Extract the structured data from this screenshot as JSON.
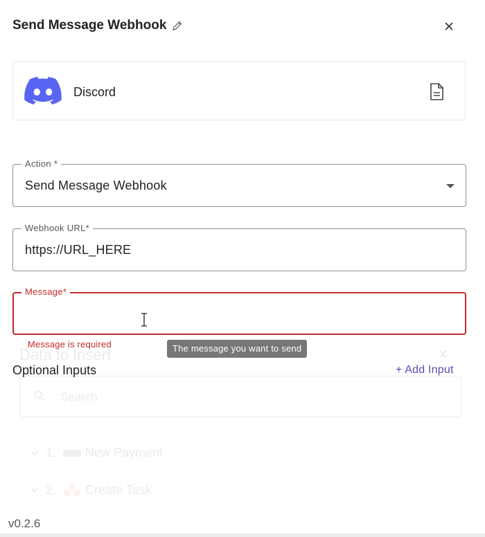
{
  "header": {
    "title": "Send Message Webhook",
    "edit_icon": "pencil-icon",
    "close_icon": "close-icon"
  },
  "app": {
    "name": "Discord",
    "logo": "discord-logo",
    "doc_icon": "document-icon",
    "brand_color": "#5865F2"
  },
  "fields": {
    "action": {
      "label": "Action *",
      "value": "Send Message Webhook"
    },
    "webhook": {
      "label": "Webhook URL*",
      "value": "https://URL_HERE"
    },
    "message": {
      "label": "Message*",
      "value": "",
      "error": "Message is required",
      "tooltip": "The message you want to send",
      "error_color": "#c62828"
    }
  },
  "optional": {
    "label": "Optional Inputs",
    "add_label": "+ Add Input"
  },
  "ghost_panel": {
    "title": "Data to Insert",
    "search_placeholder": "Search",
    "items": [
      {
        "index": "1.",
        "label": "New Payment"
      },
      {
        "index": "2.",
        "label": "Create Task"
      }
    ]
  },
  "footer": {
    "version": "v0.2.6"
  }
}
